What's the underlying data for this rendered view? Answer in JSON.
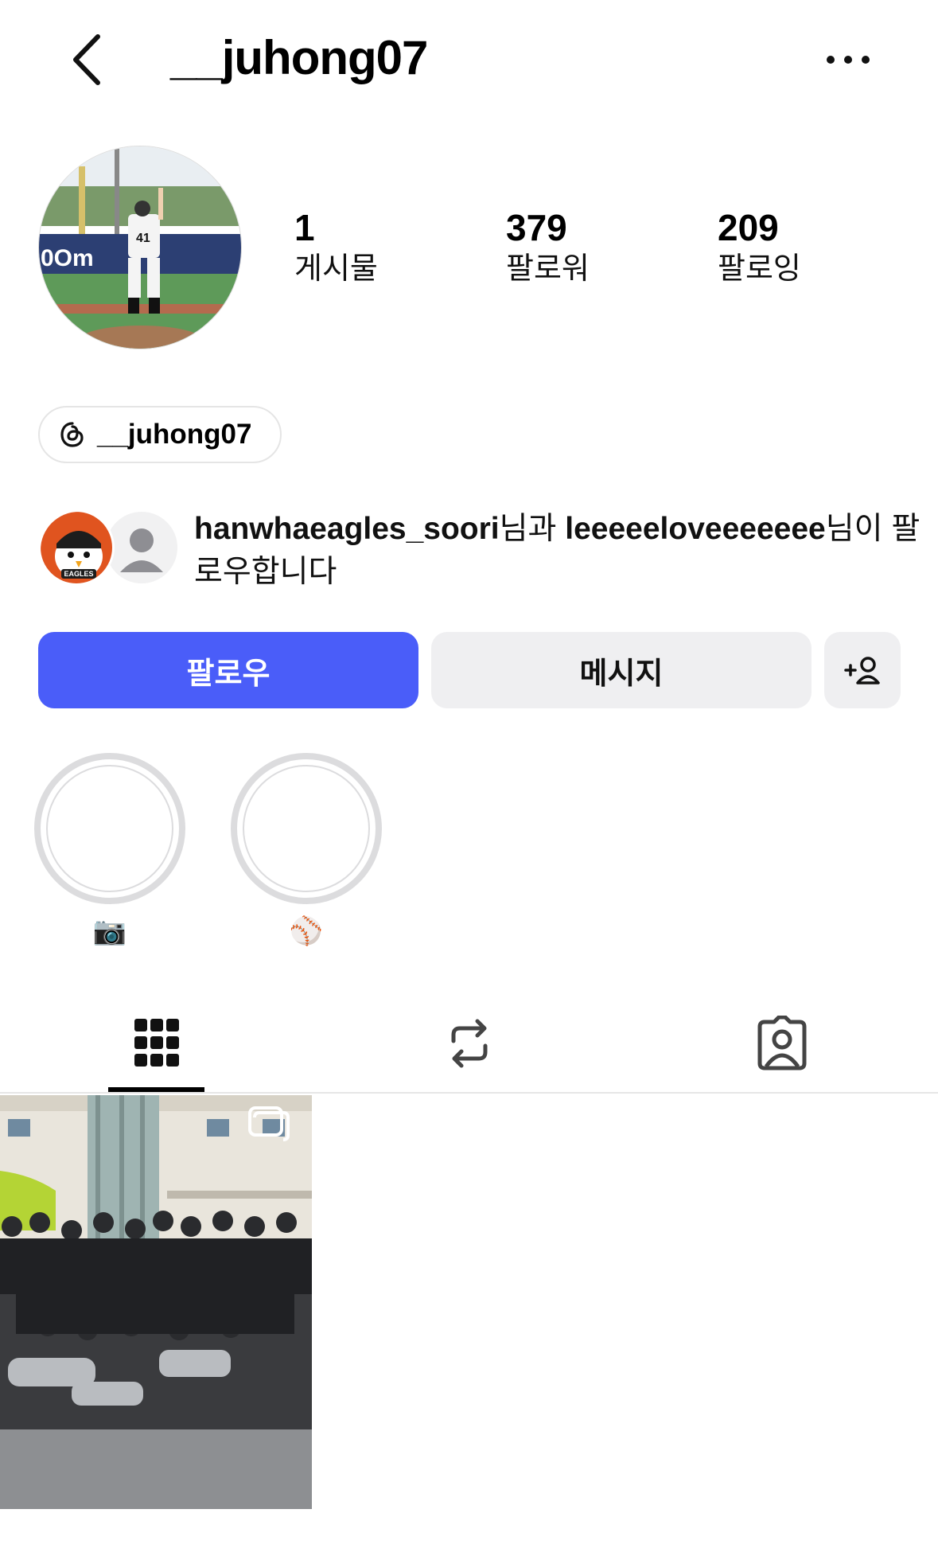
{
  "header": {
    "username": "__juhong07",
    "back_icon": "chevron-left-icon",
    "more_icon": "more-horizontal-icon"
  },
  "profile": {
    "avatar_icon": "profile-photo"
  },
  "stats": {
    "posts": {
      "value": "1",
      "label": "게시물"
    },
    "followers": {
      "value": "379",
      "label": "팔로워"
    },
    "following": {
      "value": "209",
      "label": "팔로잉"
    }
  },
  "threads": {
    "handle": "__juhong07",
    "icon": "threads-icon"
  },
  "mutuals": {
    "user1": "hanwhaeagles_soori",
    "connector1": "님과 ",
    "user2": "leeeeeloveeeeeee",
    "suffix": "님이 팔로우합니다"
  },
  "actions": {
    "follow_label": "팔로우",
    "message_label": "메시지",
    "suggest_icon": "add-person-icon",
    "accent_color": "#4a5df9"
  },
  "highlights": [
    {
      "label": "📷"
    },
    {
      "label": "⚾"
    }
  ],
  "tabs": [
    {
      "icon": "grid-icon",
      "active": true
    },
    {
      "icon": "repost-icon",
      "active": false
    },
    {
      "icon": "tagged-icon",
      "active": false
    }
  ],
  "posts": [
    {
      "icon": "team-photo",
      "multi_image": true
    }
  ]
}
